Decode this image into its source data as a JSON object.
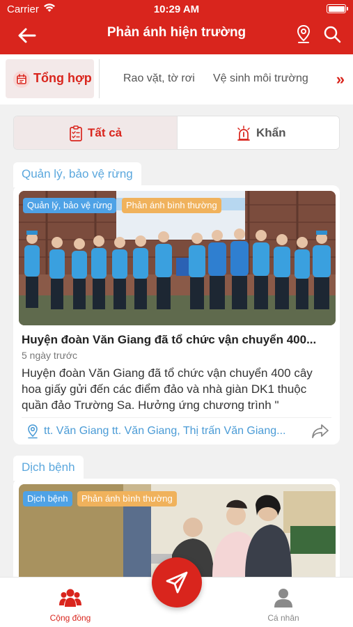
{
  "status_bar": {
    "carrier": "Carrier",
    "time": "10:29 AM"
  },
  "header": {
    "title": "Phản ánh hiện trường"
  },
  "categories": {
    "active": "Tổng hợp",
    "items": [
      "Rao vặt, tờ rơi",
      "Vệ sinh môi trường"
    ],
    "more": "»"
  },
  "filter": {
    "all_label": "Tất cả",
    "urgent_label": "Khẩn"
  },
  "posts": [
    {
      "section": "Quản lý, bảo vệ rừng",
      "badge_category": "Quản lý, bảo vệ rừng",
      "badge_status": "Phản ánh bình thường",
      "title": "Huyện đoàn Văn Giang đã tổ chức vận chuyển 400...",
      "time": "5 ngày trước",
      "description": "Huyện đoàn Văn Giang đã tổ chức vận chuyển 400 cây hoa giấy gửi đến các điểm đảo và nhà giàn DK1 thuộc quần đảo Trường Sa. Hưởng ứng chương trình \"",
      "location": "tt. Văn Giang tt. Văn Giang, Thị trấn Văn Giang..."
    },
    {
      "section": "Dịch bệnh",
      "badge_category": "Dịch bệnh",
      "badge_status": "Phản ánh bình thường"
    }
  ],
  "tabbar": {
    "community": "Cộng đồng",
    "profile": "Cá nhân"
  },
  "colors": {
    "primary": "#d9251d",
    "link": "#4a9bd6",
    "badge_blue": "#4ea2e6",
    "badge_orange": "#f0b25c"
  }
}
